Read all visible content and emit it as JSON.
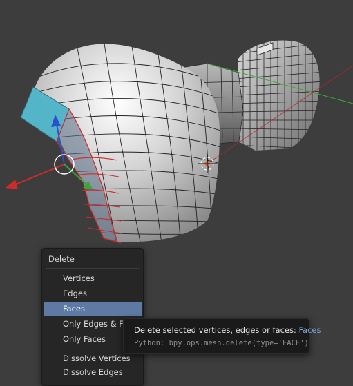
{
  "viewport": {
    "colors": {
      "background": "#3d3d3d",
      "mesh": "#c9c9c9",
      "selected_face": "#55b5c8",
      "selected_edge": "#d02a2a",
      "axis_x": "#d02a2a",
      "axis_y": "#3aa63a",
      "axis_z": "#2a4fd0"
    }
  },
  "delete_menu": {
    "title": "Delete",
    "items": [
      {
        "label": "Vertices"
      },
      {
        "label": "Edges"
      },
      {
        "label": "Faces",
        "active": true
      },
      {
        "label": "Only Edges & Faces"
      },
      {
        "label": "Only Faces"
      },
      {
        "label": "Dissolve Vertices"
      },
      {
        "label": "Dissolve Edges"
      }
    ]
  },
  "tooltip": {
    "description": "Delete selected vertices, edges or faces:",
    "value": "Faces",
    "python": "Python: bpy.ops.mesh.delete(type='FACE')"
  }
}
